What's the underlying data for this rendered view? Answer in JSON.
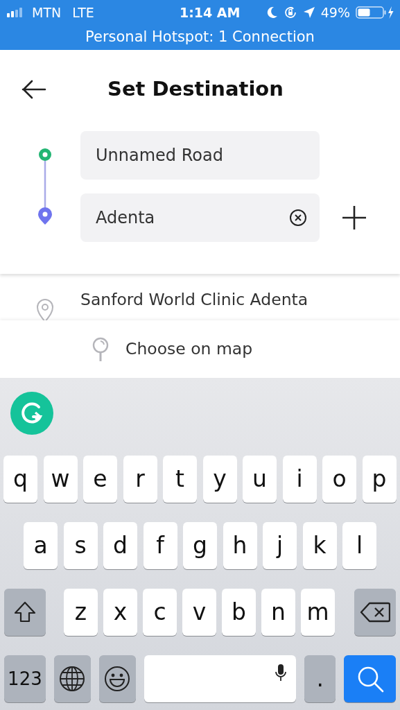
{
  "status_bar": {
    "carrier": "MTN",
    "network": "LTE",
    "time": "1:14 AM",
    "battery": "49%"
  },
  "hotspot_banner": "Personal Hotspot: 1 Connection",
  "header": {
    "title": "Set Destination"
  },
  "route": {
    "origin": {
      "value": "Unnamed Road"
    },
    "destination": {
      "value": "Adenta"
    }
  },
  "suggestions": [
    {
      "title": "Sanford World Clinic Adenta"
    }
  ],
  "choose_on_map": "Choose on map",
  "keyboard": {
    "rows": [
      {
        "keys": [
          {
            "kind": "letter",
            "label": "q"
          },
          {
            "kind": "letter",
            "label": "w"
          },
          {
            "kind": "letter",
            "label": "e"
          },
          {
            "kind": "letter",
            "label": "r"
          },
          {
            "kind": "letter",
            "label": "t"
          },
          {
            "kind": "letter",
            "label": "y"
          },
          {
            "kind": "letter",
            "label": "u"
          },
          {
            "kind": "letter",
            "label": "i"
          },
          {
            "kind": "letter",
            "label": "o"
          },
          {
            "kind": "letter",
            "label": "p"
          }
        ]
      },
      {
        "keys": [
          {
            "kind": "letter",
            "label": "a"
          },
          {
            "kind": "letter",
            "label": "s"
          },
          {
            "kind": "letter",
            "label": "d"
          },
          {
            "kind": "letter",
            "label": "f"
          },
          {
            "kind": "letter",
            "label": "g"
          },
          {
            "kind": "letter",
            "label": "h"
          },
          {
            "kind": "letter",
            "label": "j"
          },
          {
            "kind": "letter",
            "label": "k"
          },
          {
            "kind": "letter",
            "label": "l"
          }
        ]
      },
      {
        "keys": [
          {
            "kind": "shift"
          },
          {
            "kind": "letter",
            "label": "z"
          },
          {
            "kind": "letter",
            "label": "x"
          },
          {
            "kind": "letter",
            "label": "c"
          },
          {
            "kind": "letter",
            "label": "v"
          },
          {
            "kind": "letter",
            "label": "b"
          },
          {
            "kind": "letter",
            "label": "n"
          },
          {
            "kind": "letter",
            "label": "m"
          },
          {
            "kind": "backspace"
          }
        ]
      },
      {
        "keys": [
          {
            "kind": "numbers",
            "label": "123"
          },
          {
            "kind": "globe"
          },
          {
            "kind": "emoji"
          },
          {
            "kind": "space"
          },
          {
            "kind": "period",
            "label": "."
          },
          {
            "kind": "search"
          }
        ]
      }
    ]
  }
}
